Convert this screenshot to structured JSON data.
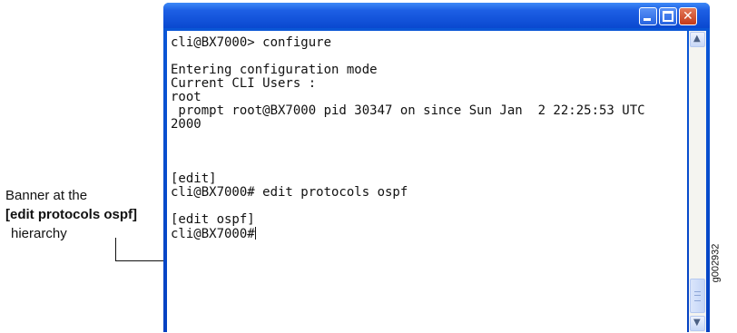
{
  "callout": {
    "line1": "Banner at the",
    "line2_open": "[",
    "line2_bold": "edit protocols ospf",
    "line2_close": "]",
    "line3": "hierarchy"
  },
  "figure_id": "g002932",
  "window": {
    "title": "",
    "buttons": [
      "minimize",
      "maximize",
      "close"
    ]
  },
  "terminal": {
    "prompt_configure": "cli@BX7000> configure",
    "entering": "Entering configuration mode",
    "users_heading": "Current CLI Users :",
    "user": "root",
    "session_line1": " prompt root@BX7000 pid 30347 on since Sun Jan  2 22:25:53 UTC",
    "session_line2": "2000",
    "banner_edit": "[edit]",
    "cmd_edit_ospf": "cli@BX7000# edit protocols ospf",
    "banner_edit_ospf": "[edit ospf]",
    "prompt_final": "cli@BX7000#"
  },
  "icons": {
    "minimize": "minimize-icon",
    "maximize": "maximize-icon",
    "close": "close-icon",
    "scroll_up": "scroll-up-arrow-icon",
    "scroll_down": "scroll-down-arrow-icon"
  }
}
